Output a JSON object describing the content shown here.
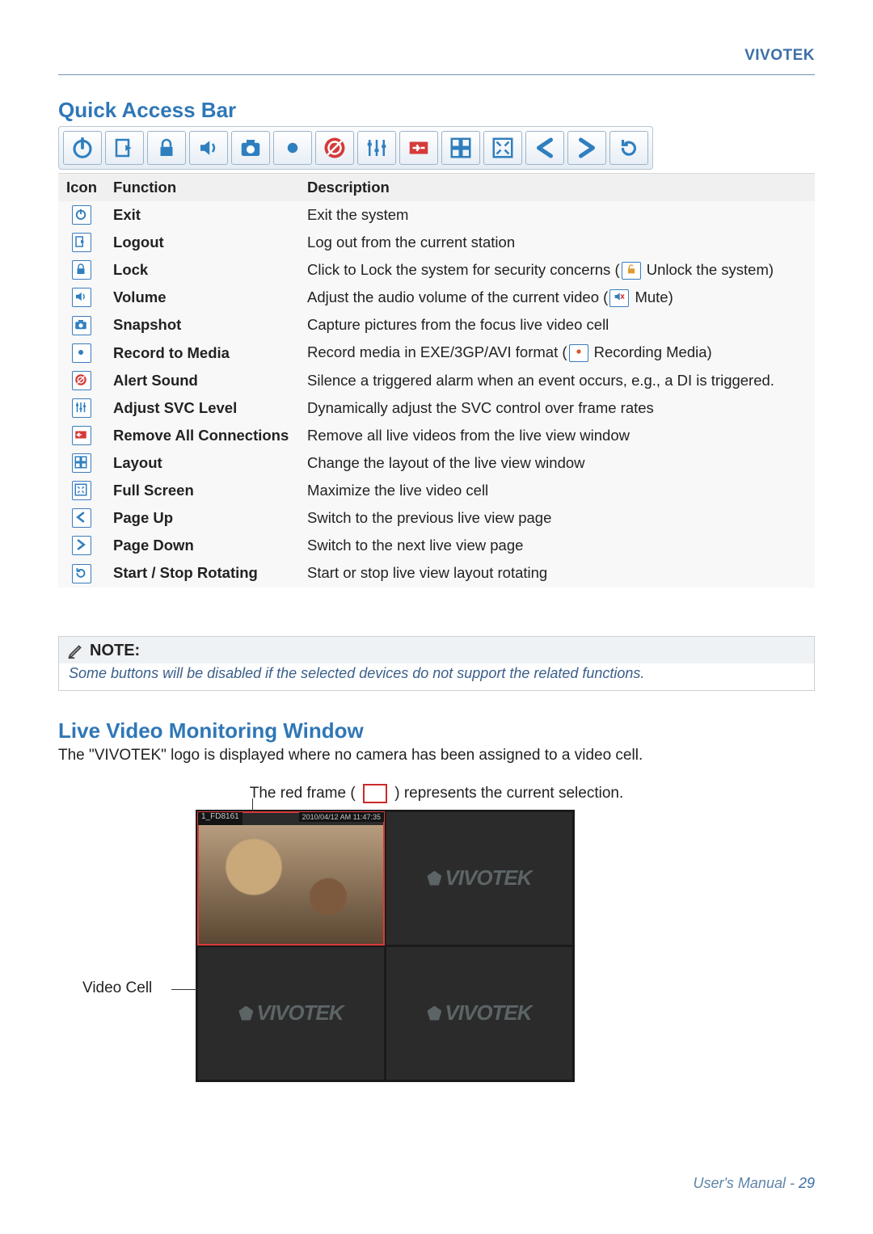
{
  "brand": "VIVOTEK",
  "section1_title": "Quick Access Bar",
  "table": {
    "headers": {
      "icon": "Icon",
      "function": "Function",
      "description": "Description"
    },
    "rows": [
      {
        "id": "exit",
        "function": "Exit",
        "desc_pre": "Exit the system",
        "inline_icon": null,
        "desc_post": ""
      },
      {
        "id": "logout",
        "function": "Logout",
        "desc_pre": "Log out from the current station",
        "inline_icon": null,
        "desc_post": ""
      },
      {
        "id": "lock",
        "function": "Lock",
        "desc_pre": "Click to Lock the system for security concerns (",
        "inline_icon": "unlock",
        "desc_post": " Unlock the system)"
      },
      {
        "id": "volume",
        "function": "Volume",
        "desc_pre": "Adjust the audio volume of the current video (",
        "inline_icon": "mute",
        "desc_post": " Mute)"
      },
      {
        "id": "snapshot",
        "function": "Snapshot",
        "desc_pre": "Capture pictures from the focus live video cell",
        "inline_icon": null,
        "desc_post": ""
      },
      {
        "id": "record",
        "function": "Record to Media",
        "desc_pre": "Record media in EXE/3GP/AVI format (",
        "inline_icon": "recording",
        "desc_post": " Recording Media)"
      },
      {
        "id": "alert",
        "function": "Alert Sound",
        "desc_pre": "Silence a triggered alarm when an event occurs, e.g., a DI is triggered.",
        "inline_icon": null,
        "desc_post": ""
      },
      {
        "id": "svc",
        "function": "Adjust SVC Level",
        "desc_pre": "Dynamically adjust the SVC control over frame rates",
        "inline_icon": null,
        "desc_post": ""
      },
      {
        "id": "remove",
        "function": "Remove All Connections",
        "desc_pre": "Remove all live videos from the live view window",
        "inline_icon": null,
        "desc_post": ""
      },
      {
        "id": "layout",
        "function": "Layout",
        "desc_pre": "Change the layout of the live view window",
        "inline_icon": null,
        "desc_post": ""
      },
      {
        "id": "fullscreen",
        "function": "Full Screen",
        "desc_pre": "Maximize the live video cell",
        "inline_icon": null,
        "desc_post": ""
      },
      {
        "id": "pageup",
        "function": "Page Up",
        "desc_pre": "Switch to the previous live view page",
        "inline_icon": null,
        "desc_post": ""
      },
      {
        "id": "pagedown",
        "function": "Page Down",
        "desc_pre": "Switch to the next live view page",
        "inline_icon": null,
        "desc_post": ""
      },
      {
        "id": "rotate",
        "function": "Start / Stop Rotating",
        "desc_pre": "Start or stop live view layout rotating",
        "inline_icon": null,
        "desc_post": ""
      }
    ]
  },
  "note": {
    "title": "NOTE:",
    "text": "Some buttons will be disabled if the selected devices do not support the related functions."
  },
  "section2_title": "Live Video Monitoring Window",
  "live": {
    "intro": "The \"VIVOTEK\" logo is displayed where no camera has been assigned to a video cell.",
    "redframe_pre": "The red frame (",
    "redframe_post": ") represents the current selection.",
    "videocell_label": "Video Cell",
    "cell1_title": "1_FD8161",
    "cell1_time": "2010/04/12 AM 11:47:35",
    "logo_text": "VIVOTEK"
  },
  "footer": {
    "manual": "User's Manual - ",
    "page": "29"
  }
}
